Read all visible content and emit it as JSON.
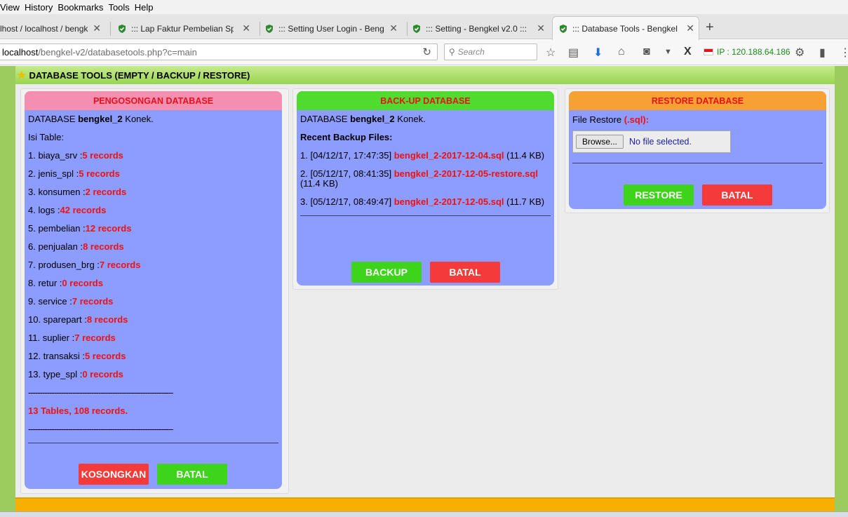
{
  "menu": [
    "View",
    "History",
    "Bookmarks",
    "Tools",
    "Help"
  ],
  "tabs": [
    {
      "title": "lhost / localhost / bengk",
      "active": false
    },
    {
      "title": "::: Lap Faktur Pembelian Spa",
      "active": false
    },
    {
      "title": "::: Setting User Login - Bengk",
      "active": false
    },
    {
      "title": "::: Setting - Bengkel v2.0 :::",
      "active": false
    },
    {
      "title": "::: Database Tools - Bengkel",
      "active": true
    }
  ],
  "url": {
    "host": "localhost",
    "path": "/bengkel-v2/databasetools.php?c=main"
  },
  "search": {
    "placeholder": "Search"
  },
  "ip_text": "IP : 120.188.64.186",
  "page_title": "DATABASE TOOLS (EMPTY / BACKUP / RESTORE)",
  "empty_panel": {
    "header": "PENGOSONGAN DATABASE",
    "db_prefix": "DATABASE",
    "db_name": "bengkel_2",
    "db_suffix": "Konek.",
    "tables_label": "Isi Table:",
    "tables": [
      {
        "label": "1. biaya_srv :",
        "count": "5 records"
      },
      {
        "label": "2. jenis_spl :",
        "count": "5 records"
      },
      {
        "label": "3. konsumen :",
        "count": "2 records"
      },
      {
        "label": "4. logs :",
        "count": "42 records"
      },
      {
        "label": "5. pembelian :",
        "count": "12 records"
      },
      {
        "label": "6. penjualan :",
        "count": "8 records"
      },
      {
        "label": "7. produsen_brg :",
        "count": "7 records"
      },
      {
        "label": "8. retur :",
        "count": "0 records"
      },
      {
        "label": "9. service :",
        "count": "7 records"
      },
      {
        "label": "10. sparepart :",
        "count": "8 records"
      },
      {
        "label": "11. suplier :",
        "count": "7 records"
      },
      {
        "label": "12. transaksi :",
        "count": "5 records"
      },
      {
        "label": "13. type_spl :",
        "count": "0 records"
      }
    ],
    "separator": "--------------------------------------------------------------",
    "summary": "13 Tables, 108 records.",
    "btn_empty": "KOSONGKAN",
    "btn_cancel": "BATAL"
  },
  "backup_panel": {
    "header": "BACK-UP DATABASE",
    "db_prefix": "DATABASE",
    "db_name": "bengkel_2",
    "db_suffix": "Konek.",
    "recent_label": "Recent Backup Files:",
    "files": [
      {
        "prefix": "1. [04/12/17, 17:47:35]",
        "name": "bengkel_2-2017-12-04.sql",
        "size": "(11.4 KB)"
      },
      {
        "prefix": "2. [05/12/17, 08:41:35]",
        "name": "bengkel_2-2017-12-05-restore.sql",
        "size": "(11.4 KB)"
      },
      {
        "prefix": "3. [05/12/17, 08:49:47]",
        "name": "bengkel_2-2017-12-05.sql",
        "size": "(11.7 KB)"
      }
    ],
    "btn_backup": "BACKUP",
    "btn_cancel": "BATAL"
  },
  "restore_panel": {
    "header": "RESTORE DATABASE",
    "file_label": "File Restore",
    "file_ext": "(.sql):",
    "browse_label": "Browse...",
    "no_file": "No file selected.",
    "btn_restore": "RESTORE",
    "btn_cancel": "BATAL"
  },
  "colors": {
    "panel_bg": "#8d9cff",
    "empty_header": "#f48fb1",
    "backup_header": "#4fdc2e",
    "restore_header": "#f7a135",
    "accent_red": "#ee1111",
    "button_green": "#3fd41c",
    "button_red": "#f53a3a"
  }
}
